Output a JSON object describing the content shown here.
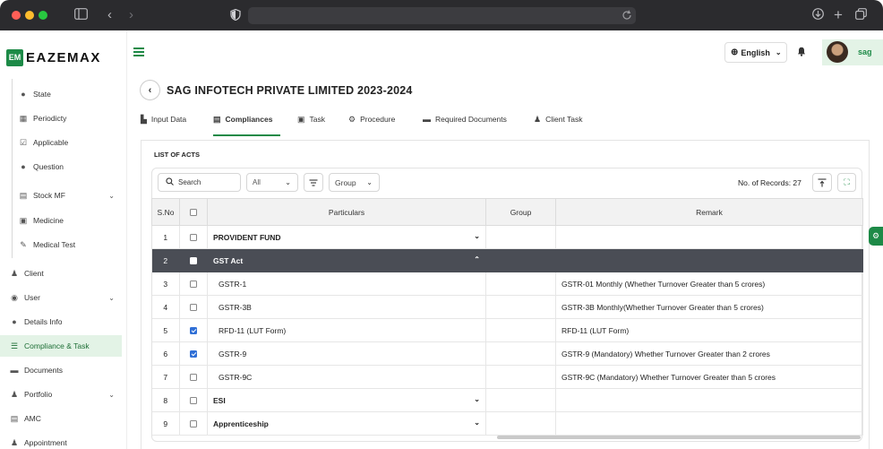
{
  "brand": {
    "logo_mark": "EM",
    "logo_text": "EAZEMAX"
  },
  "sidebar": {
    "items": [
      {
        "label": "State",
        "icon": "location-icon",
        "level": "sub"
      },
      {
        "label": "Periodicty",
        "icon": "calendar-icon",
        "level": "sub"
      },
      {
        "label": "Applicable",
        "icon": "check-list-icon",
        "level": "sub"
      },
      {
        "label": "Question",
        "icon": "question-icon",
        "level": "sub"
      },
      {
        "label": "Stock MF",
        "icon": "stock-icon",
        "level": "sub",
        "chevron": "⌄"
      },
      {
        "label": "Medicine",
        "icon": "medicine-icon",
        "level": "sub"
      },
      {
        "label": "Medical Test",
        "icon": "medical-test-icon",
        "level": "sub"
      },
      {
        "label": "Client",
        "icon": "client-icon",
        "level": "top"
      },
      {
        "label": "User",
        "icon": "user-icon",
        "level": "top",
        "chevron": "⌄"
      },
      {
        "label": "Details Info",
        "icon": "info-icon",
        "level": "top"
      },
      {
        "label": "Compliance & Task",
        "icon": "compliance-icon",
        "level": "top",
        "active": true
      },
      {
        "label": "Documents",
        "icon": "documents-icon",
        "level": "top"
      },
      {
        "label": "Portfolio",
        "icon": "portfolio-icon",
        "level": "top",
        "chevron": "⌄"
      },
      {
        "label": "AMC",
        "icon": "amc-icon",
        "level": "top"
      },
      {
        "label": "Appointment",
        "icon": "appointment-icon",
        "level": "top"
      }
    ]
  },
  "topbar": {
    "language": "English",
    "user_name": "sag"
  },
  "page": {
    "title": "SAG INFOTECH PRIVATE LIMITED 2023-2024",
    "tabs": [
      {
        "label": "Input Data",
        "icon": "input-data-icon"
      },
      {
        "label": "Compliances",
        "icon": "compliances-icon",
        "active": true
      },
      {
        "label": "Task",
        "icon": "task-icon"
      },
      {
        "label": "Procedure",
        "icon": "procedure-icon"
      },
      {
        "label": "Required Documents",
        "icon": "required-documents-icon"
      },
      {
        "label": "Client Task",
        "icon": "client-task-icon"
      }
    ],
    "list_title": "LIST OF ACTS"
  },
  "toolbar": {
    "search_placeholder": "Search",
    "filter_value": "All",
    "group_value": "Group",
    "records_label": "No. of Records: 27"
  },
  "table": {
    "headers": {
      "sno": "S.No",
      "particulars": "Particulars",
      "group": "Group",
      "remark": "Remark"
    },
    "rows": [
      {
        "sno": "1",
        "particulars": "PROVIDENT FUND",
        "group": "",
        "remark": "",
        "checked": false,
        "kind": "parent",
        "chevron": "⌄"
      },
      {
        "sno": "2",
        "particulars": "GST Act",
        "group": "",
        "remark": "",
        "checked": false,
        "kind": "parent-open",
        "chevron": "⌃"
      },
      {
        "sno": "3",
        "particulars": "GSTR-1",
        "group": "",
        "remark": "GSTR-01 Monthly (Whether Turnover Greater than 5 crores)",
        "checked": false,
        "kind": "child"
      },
      {
        "sno": "4",
        "particulars": "GSTR-3B",
        "group": "",
        "remark": "GSTR-3B Monthly(Whether Turnover Greater than 5 crores)",
        "checked": false,
        "kind": "child"
      },
      {
        "sno": "5",
        "particulars": "RFD-11 (LUT Form)",
        "group": "",
        "remark": "RFD-11 (LUT Form)",
        "checked": true,
        "kind": "child"
      },
      {
        "sno": "6",
        "particulars": "GSTR-9",
        "group": "",
        "remark": "GSTR-9 (Mandatory) Whether Turnover Greater than 2 crores",
        "checked": true,
        "kind": "child"
      },
      {
        "sno": "7",
        "particulars": "GSTR-9C",
        "group": "",
        "remark": "GSTR-9C (Mandatory) Whether Turnover Greater than 5 crores",
        "checked": false,
        "kind": "child"
      },
      {
        "sno": "8",
        "particulars": "ESI",
        "group": "",
        "remark": "",
        "checked": false,
        "kind": "parent",
        "chevron": "⌄"
      },
      {
        "sno": "9",
        "particulars": "Apprenticeship",
        "group": "",
        "remark": "",
        "checked": false,
        "kind": "parent",
        "chevron": "⌄"
      }
    ]
  },
  "colors": {
    "accent": "#1d8a47",
    "active_bg": "#e3f3e6",
    "highlight_row": "#4a4d55",
    "checkbox": "#2f6fd6"
  }
}
